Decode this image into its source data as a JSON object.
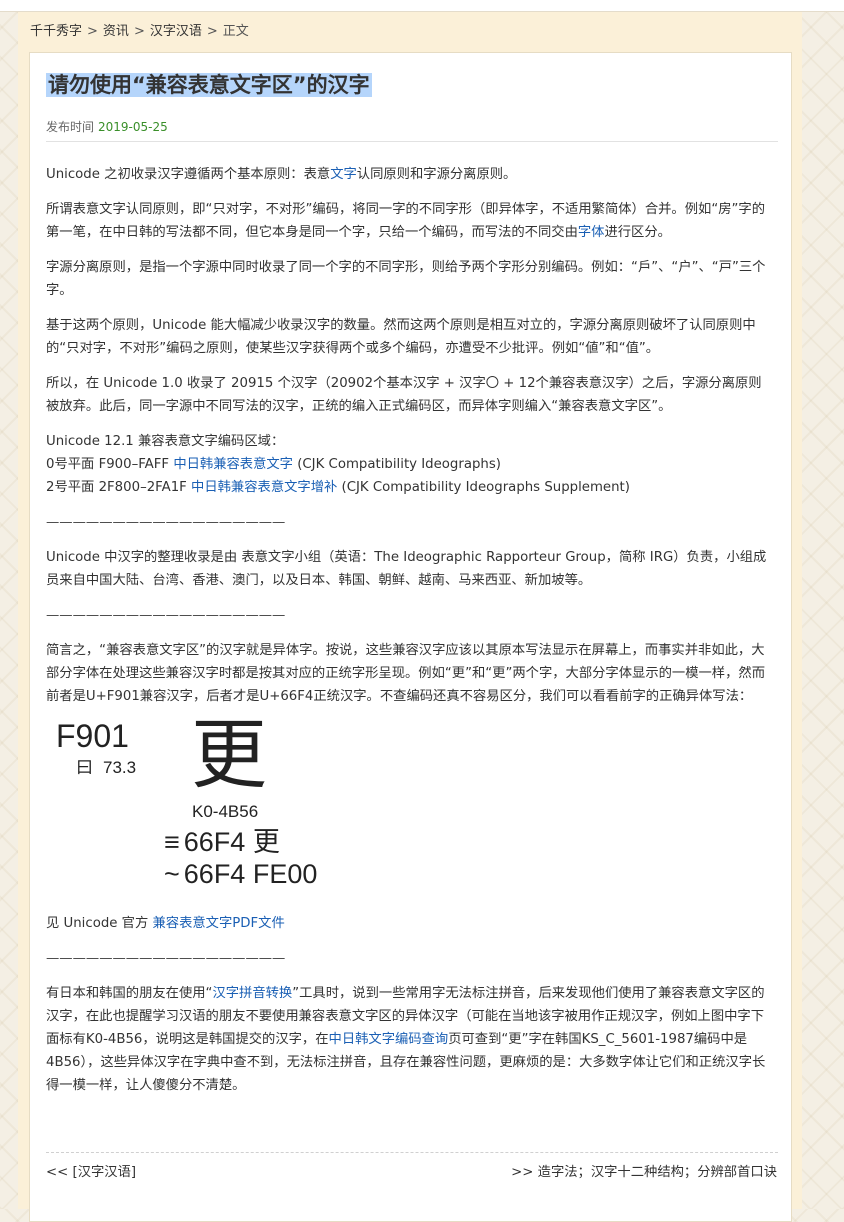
{
  "breadcrumb": {
    "items": [
      "千千秀字",
      "资讯",
      "汉字汉语"
    ],
    "separator": ">",
    "current": "正文"
  },
  "article": {
    "title": "请勿使用“兼容表意文字区”的汉字",
    "publish_label": "发布时间",
    "publish_date": "2019-05-25",
    "p1": {
      "before": "Unicode 之初收录汉字遵循两个基本原则：表意",
      "link": "文字",
      "after": "认同原则和字源分离原则。"
    },
    "p2": {
      "before": "所谓表意文字认同原则，即“只对字，不对形”编码，将同一字的不同字形（即异体字，不适用繁简体）合并。例如“房”字的第一笔，在中日韩的写法都不同，但它本身是同一个字，只给一个编码，而写法的不同交由",
      "link": "字体",
      "after": "进行区分。"
    },
    "p3": "字源分离原则，是指一个字源中同时收录了同一个字的不同字形，则给予两个字形分别编码。例如：“戶”、“户”、“戸”三个字。",
    "p4": "基于这两个原则，Unicode 能大幅减少收录汉字的数量。然而这两个原则是相互对立的，字源分离原则破坏了认同原则中的“只对字，不对形”编码之原则，使某些汉字获得两个或多个编码，亦遭受不少批评。例如“値”和“值”。",
    "p5": "所以，在 Unicode 1.0 收录了 20915 个汉字（20902个基本汉字 + 汉字〇 + 12个兼容表意汉字）之后，字源分离原则被放弃。此后，同一字源中不同写法的汉字，正统的编入正式编码区，而异体字则编入“兼容表意文字区”。",
    "ranges": {
      "heading": "Unicode 12.1 兼容表意文字编码区域：",
      "line1_prefix": "0号平面 F900–FAFF ",
      "line1_link": "中日韩兼容表意文字",
      "line1_suffix": " (CJK Compatibility Ideographs)",
      "line2_prefix": "2号平面 2F800–2FA1F ",
      "line2_link": "中日韩兼容表意文字增补",
      "line2_suffix": " (CJK Compatibility Ideographs Supplement)"
    },
    "divider": "——————————————————",
    "p6": "Unicode 中汉字的整理收录是由 表意文字小组（英语：The Ideographic Rapporteur Group，简称 IRG）负责，小组成员来自中国大陆、台湾、香港、澳门，以及日本、韩国、朝鲜、越南、马来西亚、新加坡等。",
    "p7": "简言之，“兼容表意文字区”的汉字就是异体字。按说，这些兼容汉字应该以其原本写法显示在屏幕上，而事实并非如此，大部分字体在处理这些兼容汉字时都是按其对应的正统字形呈现。例如“更”和“更”两个字，大部分字体显示的一模一样，然而前者是U+F901兼容汉字，后者才是U+66F4正统汉字。不查编码还真不容易区分，我们可以看看前字的正确异体写法：",
    "figure": {
      "code": "F901",
      "radical_char": "曰",
      "radical_value": "73.3",
      "glyph": "更",
      "source": "K0-4B56",
      "equiv_symbol": "≡",
      "equiv_code": "66F4",
      "equiv_char": "更",
      "variant_symbol": "~",
      "variant_code": "66F4 FE00"
    },
    "see_also": {
      "before": "见 Unicode 官方 ",
      "link": "兼容表意文字PDF文件"
    },
    "p8": {
      "part1": "有日本和韩国的朋友在使用“",
      "link1": "汉字拼音转换",
      "part2": "”工具时，说到一些常用字无法标注拼音，后来发现他们使用了兼容表意文字区的汉字，在此也提醒学习汉语的朋友不要使用兼容表意文字区的异体汉字（可能在当地该字被用作正规汉字，例如上图中字下面标有K0-4B56，说明这是韩国提交的汉字，在",
      "link2": "中日韩文字编码查询",
      "part3": "页可查到“更”字在韩国KS_C_5601-1987编码中是4B56），这些异体汉字在字典中查不到，无法标注拼音，且存在兼容性问题，更麻烦的是：大多数字体让它们和正统汉字长得一模一样，让人傻傻分不清楚。"
    }
  },
  "navigation": {
    "prev": "<< [汉字汉语]",
    "next": ">> 造字法；汉字十二种结构；分辨部首口诀"
  }
}
